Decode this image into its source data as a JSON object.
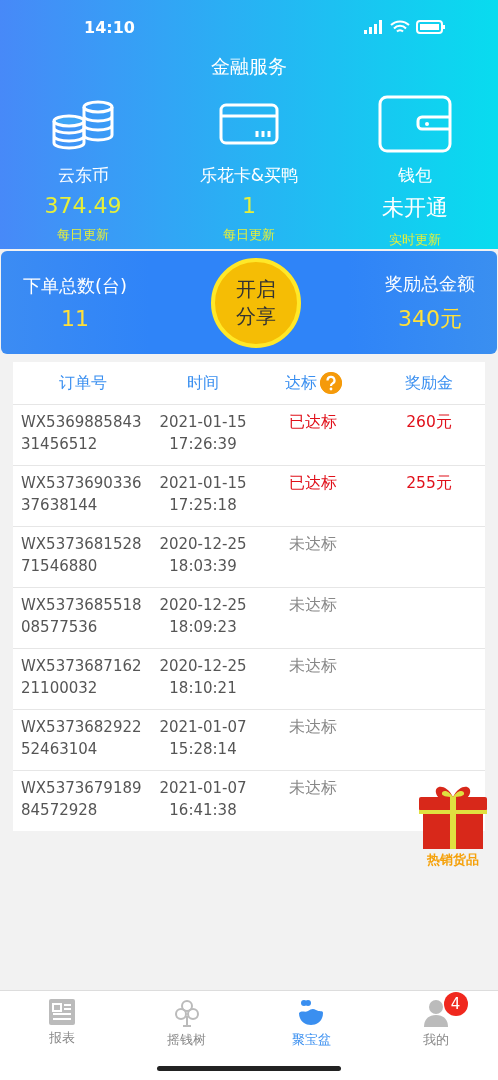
{
  "status_bar": {
    "time": "14:10"
  },
  "header": {
    "title": "金融服务",
    "items": [
      {
        "kind": "coins",
        "label": "云东币",
        "value": "374.49",
        "value_highlight": true,
        "note": "每日更新"
      },
      {
        "kind": "card",
        "label": "乐花卡&买鸭",
        "value": "1",
        "value_highlight": true,
        "note": "每日更新"
      },
      {
        "kind": "wallet",
        "label": "钱包",
        "value": "未开通",
        "value_highlight": false,
        "note": "实时更新"
      }
    ]
  },
  "summary": {
    "orders_label": "下单总数(台)",
    "orders_value": "11",
    "share_button": "开启分享",
    "reward_label": "奖励总金额",
    "reward_value": "340元"
  },
  "table": {
    "columns": [
      "订单号",
      "时间",
      "达标",
      "奖励金"
    ],
    "rows": [
      {
        "order": "WX536988584331456512",
        "time": "2021-01-15 17:26:39",
        "status": "已达标",
        "reached": true,
        "reward": "260元"
      },
      {
        "order": "WX537369033637638144",
        "time": "2021-01-15 17:25:18",
        "status": "已达标",
        "reached": true,
        "reward": "255元"
      },
      {
        "order": "WX537368152871546880",
        "time": "2020-12-25 18:03:39",
        "status": "未达标",
        "reached": false
      },
      {
        "order": "WX537368551808577536",
        "time": "2020-12-25 18:09:23",
        "status": "未达标",
        "reached": false
      },
      {
        "order": "WX537368716221100032",
        "time": "2020-12-25 18:10:21",
        "status": "未达标",
        "reached": false
      },
      {
        "order": "WX537368292252463104",
        "time": "2021-01-07 15:28:14",
        "status": "未达标",
        "reached": false
      },
      {
        "order": "WX537367918984572928",
        "time": "2021-01-07 16:41:38",
        "status": "未达标",
        "reached": false
      }
    ]
  },
  "promo": {
    "label": "热销货品"
  },
  "tab_bar": [
    {
      "kind": "report",
      "label": "报表",
      "selected": false
    },
    {
      "kind": "tree",
      "label": "摇钱树",
      "selected": false
    },
    {
      "kind": "pot",
      "label": "聚宝盆",
      "selected": true
    },
    {
      "kind": "person",
      "label": "我的",
      "selected": false,
      "badge": "4"
    }
  ]
}
